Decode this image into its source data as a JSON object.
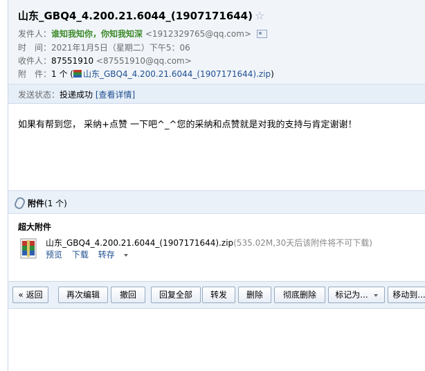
{
  "header": {
    "subject": "山东_GBQ4_4.200.21.6044_(1907171644)",
    "star_icon": "☆",
    "from_label": "发件人：",
    "from_name": "谁知我知你，你知我知深",
    "from_email": "<1912329765@qq.com>",
    "time_label": "时　间：",
    "time_value": "2021年1月5日（星期二）下午5：06",
    "to_label": "收件人：",
    "to_name": "87551910",
    "to_email": "<87551910@qq.com>",
    "attach_label": "附　件：",
    "attach_count": "1 个 (",
    "attach_file": "山东_GBQ4_4.200.21.6044_(1907171644).zip",
    "attach_close": ")"
  },
  "status": {
    "label": "发送状态：",
    "value": "投递成功",
    "details_link": "[查看详情]"
  },
  "body": {
    "text": "如果有帮到您， 采纳+点赞 一下吧^_^您的采纳和点赞就是对我的支持与肯定谢谢！"
  },
  "attachments": {
    "title": "附件",
    "count": "(1 个)",
    "section_title": "超大附件",
    "file_name": "山东_GBQ4_4.200.21.6044_(1907171644).zip",
    "file_meta": "(535.02M,30天后该附件将不可下载)",
    "action_preview": "预览",
    "action_download": "下载",
    "action_save": "转存"
  },
  "toolbar": {
    "back": "« 返回",
    "edit_again": "再次编辑",
    "recall": "撤回",
    "reply_all": "回复全部",
    "forward": "转发",
    "delete": "删除",
    "delete_permanent": "彻底删除",
    "mark_as": "标记为...",
    "move_to": "移动到..."
  }
}
